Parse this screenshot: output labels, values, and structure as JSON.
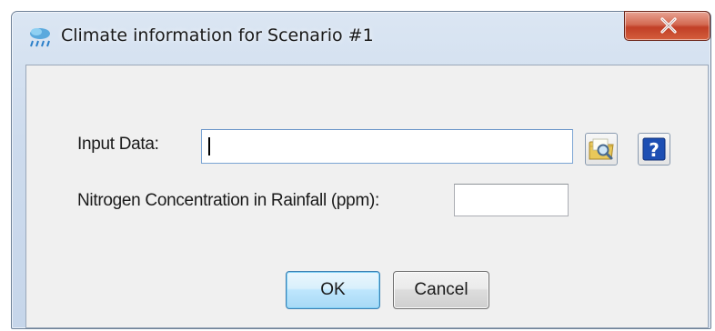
{
  "window": {
    "title": "Climate information for Scenario #1",
    "icon": "climate-app-icon",
    "close_icon": "close-x-icon"
  },
  "form": {
    "input_data_label": "Input Data:",
    "input_data_value": "",
    "nitrogen_label": "Nitrogen Concentration in Rainfall (ppm):",
    "nitrogen_value": "",
    "browse_icon": "folder-search-icon",
    "help_icon": "question-mark-icon",
    "help_glyph": "?"
  },
  "buttons": {
    "ok_label": "OK",
    "cancel_label": "Cancel"
  },
  "colors": {
    "help_blue": "#1e4fb3",
    "close_red": "#c13f26"
  }
}
